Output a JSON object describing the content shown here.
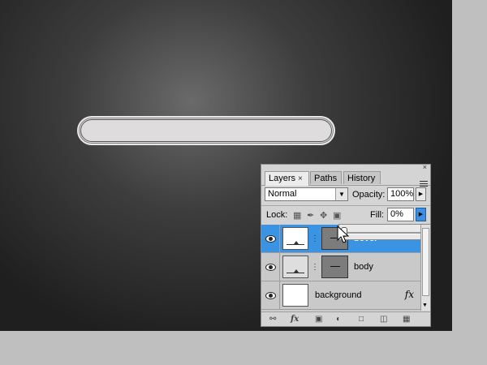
{
  "panel": {
    "tabs": [
      {
        "label": "Layers",
        "close": "×"
      },
      {
        "label": "Paths"
      },
      {
        "label": "History"
      }
    ],
    "close_glyph": "×",
    "blend_mode": "Normal",
    "opacity_label": "Opacity:",
    "opacity_value": "100%",
    "lock_label": "Lock:",
    "fill_label": "Fill:",
    "fill_value": "0%",
    "fill_slider_percent": 0,
    "layers": [
      {
        "name": "bevel",
        "visible": true,
        "selected": true
      },
      {
        "name": "body",
        "visible": true,
        "selected": false
      },
      {
        "name": "background",
        "visible": true,
        "selected": false,
        "fx": "fx"
      }
    ]
  },
  "colors": {
    "selection": "#3a93e3",
    "panel_bg": "#d4d4d4",
    "canvas_center": "#6a6a6a",
    "canvas_edge": "#1f1f1f"
  },
  "icons": [
    "close-icon",
    "panel-menu-icon",
    "dropdown-arrow-icon",
    "spinner-arrow-icon",
    "lock-transparency-icon",
    "lock-paint-icon",
    "lock-move-icon",
    "lock-all-icon",
    "eye-icon",
    "chain-link-icon",
    "fx-icon",
    "link-layers-icon",
    "add-style-icon",
    "add-mask-icon",
    "adjustment-icon",
    "new-group-icon",
    "new-layer-icon",
    "trash-icon",
    "cursor-arrow-icon"
  ]
}
